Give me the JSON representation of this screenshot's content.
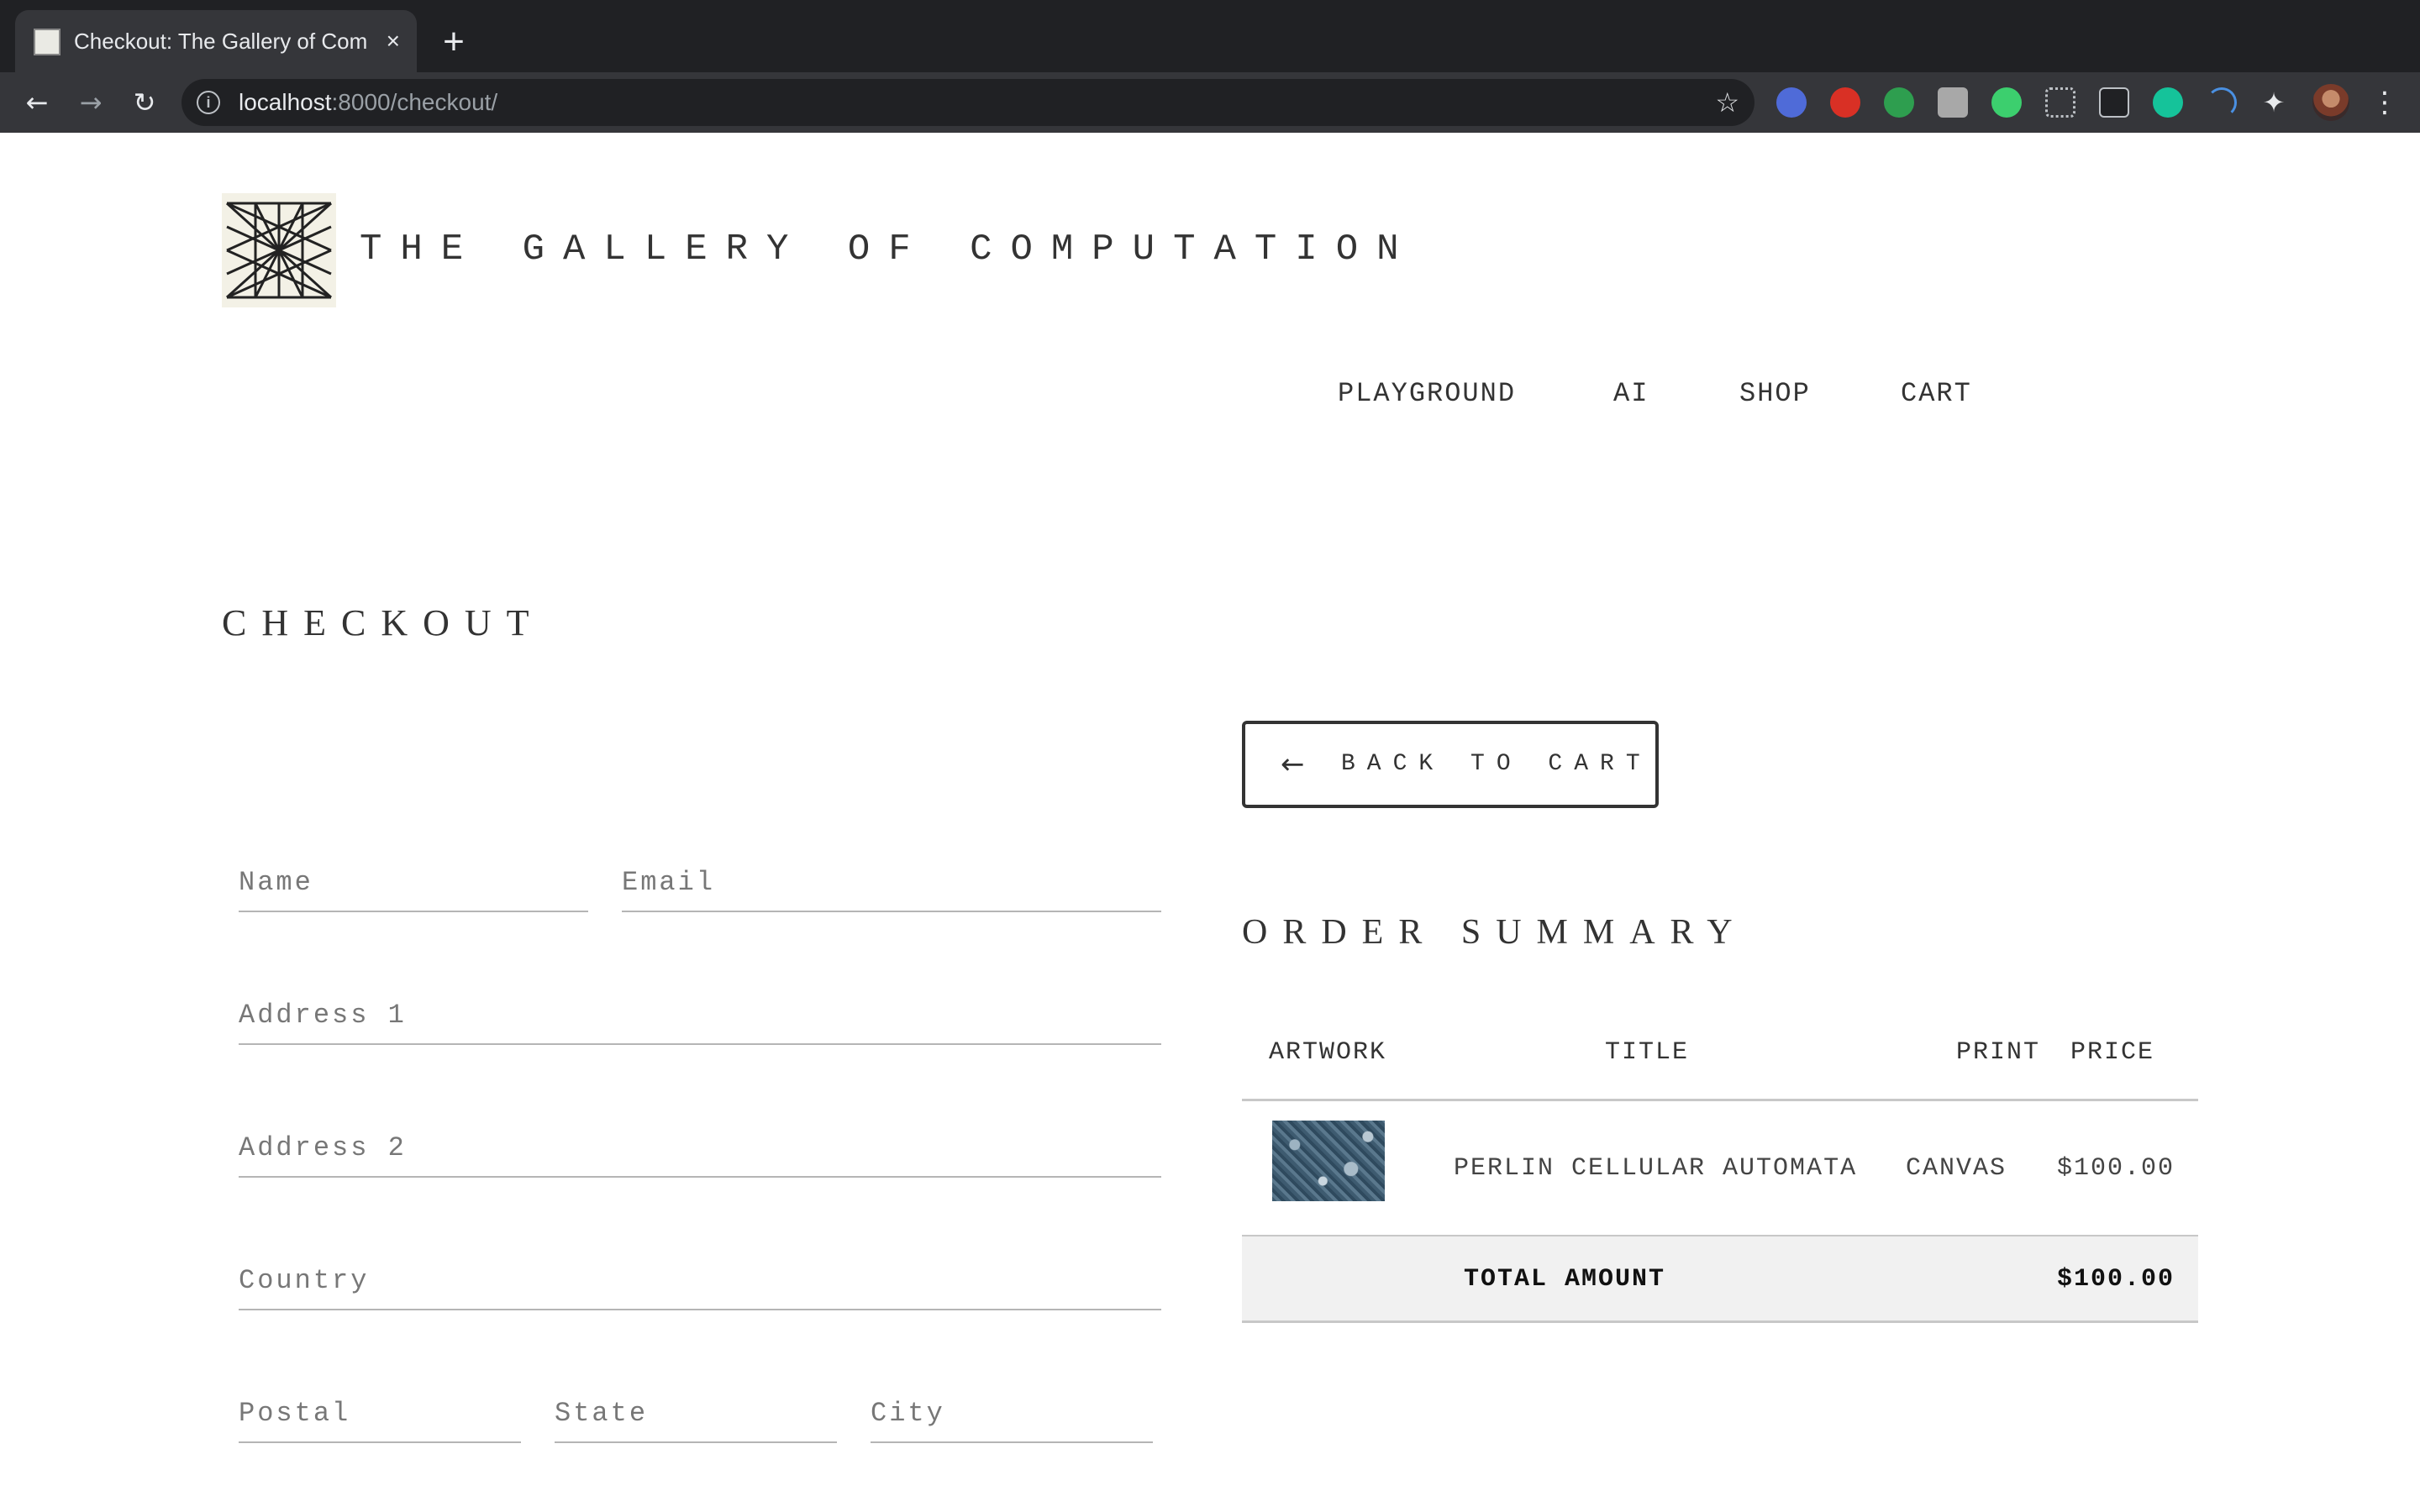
{
  "browser": {
    "tab_title": "Checkout: The Gallery of Computation",
    "tab_close": "×",
    "new_tab": "+",
    "url_host": "localhost",
    "url_path": ":8000/checkout/"
  },
  "header": {
    "brand": "THE GALLERY OF COMPUTATION",
    "nav": [
      "PLAYGROUND",
      "AI",
      "SHOP",
      "CART"
    ]
  },
  "checkout": {
    "title": "CHECKOUT",
    "fields": {
      "name": "Name",
      "email": "Email",
      "address1": "Address 1",
      "address2": "Address 2",
      "country": "Country",
      "postal": "Postal",
      "state": "State",
      "city": "City"
    }
  },
  "back_button": {
    "arrow": "←",
    "label": "BACK TO CART"
  },
  "order_summary": {
    "title": "ORDER SUMMARY",
    "columns": [
      "ARTWORK",
      "TITLE",
      "PRINT",
      "PRICE"
    ],
    "items": [
      {
        "title": "PERLIN CELLULAR AUTOMATA",
        "print": "CANVAS",
        "price": "$100.00"
      }
    ],
    "total_label": "TOTAL AMOUNT",
    "total_value": "$100.00"
  }
}
